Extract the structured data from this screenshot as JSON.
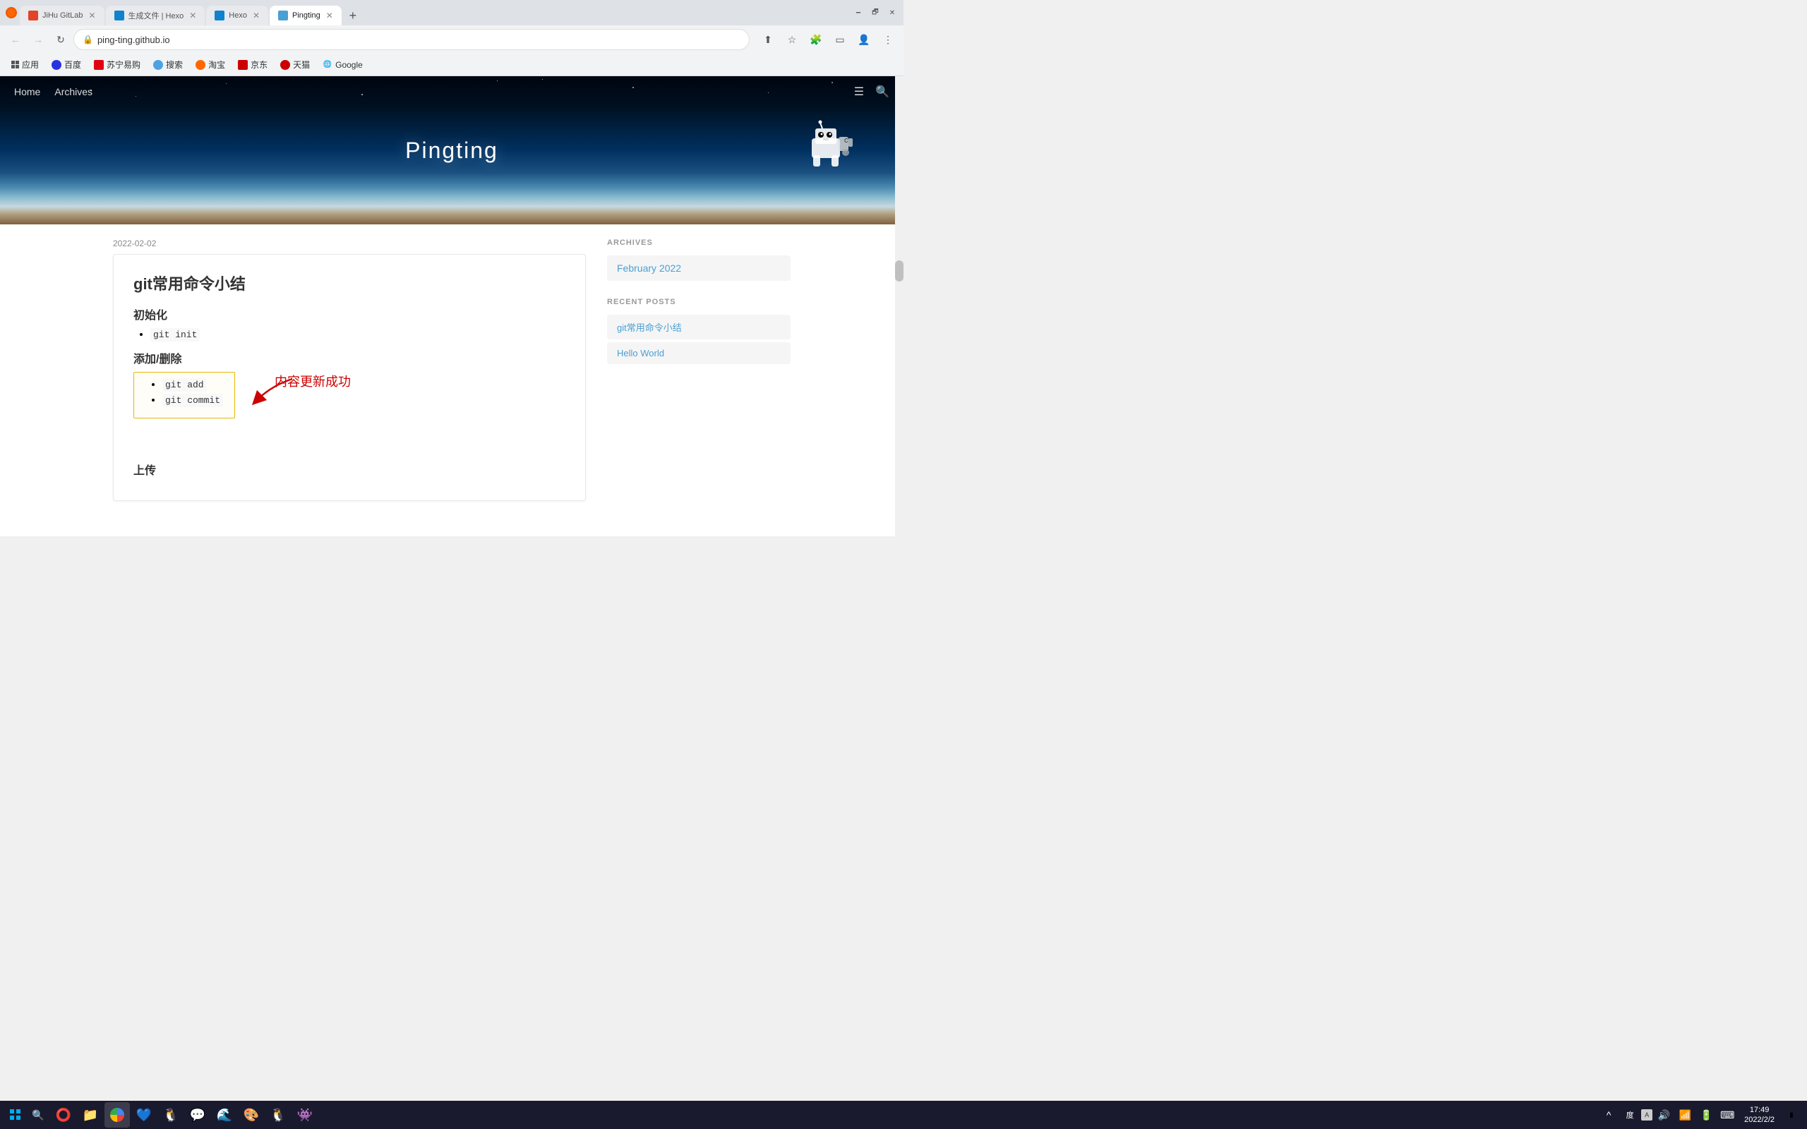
{
  "browser": {
    "tabs": [
      {
        "id": "tab1",
        "label": "JiHu GitLab",
        "favicon_color": "#e24329",
        "active": false
      },
      {
        "id": "tab2",
        "label": "生成文件 | Hexo",
        "favicon_color": "#0f83cd",
        "active": false
      },
      {
        "id": "tab3",
        "label": "Hexo",
        "favicon_color": "#0f83cd",
        "active": false
      },
      {
        "id": "tab4",
        "label": "Pingting",
        "favicon_color": "#4a9fd4",
        "active": true
      }
    ],
    "url": "ping-ting.github.io",
    "new_tab_label": "+",
    "minimize_label": "🗕",
    "maximize_label": "🗗",
    "close_label": "✕"
  },
  "bookmarks": [
    {
      "label": "应用",
      "favicon": "⬛"
    },
    {
      "label": "百度",
      "favicon": "🔵"
    },
    {
      "label": "苏宁易购",
      "favicon": "🔵"
    },
    {
      "label": "搜索",
      "favicon": "🔵"
    },
    {
      "label": "淘宝",
      "favicon": "🔵"
    },
    {
      "label": "京东",
      "favicon": "🔵"
    },
    {
      "label": "天猫",
      "favicon": "🔵"
    },
    {
      "label": "Google",
      "favicon": "🌐"
    }
  ],
  "site": {
    "title": "Pingting",
    "nav": {
      "home": "Home",
      "archives": "Archives"
    }
  },
  "post": {
    "date": "2022-02-02",
    "title": "git常用命令小结",
    "section1": {
      "heading": "初始化",
      "items": [
        "git init"
      ]
    },
    "section2": {
      "heading": "添加/删除",
      "items": [
        "git add",
        "git commit"
      ]
    },
    "section3": {
      "heading": "上传"
    },
    "annotation": "内容更新成功"
  },
  "sidebar": {
    "archives_title": "ARCHIVES",
    "archives_items": [
      {
        "label": "February 2022"
      }
    ],
    "recent_title": "RECENT POSTS",
    "recent_items": [
      {
        "label": "git常用命令小结"
      },
      {
        "label": "Hello World"
      }
    ]
  },
  "taskbar": {
    "start_icon": "⊞",
    "search_icon": "🔍",
    "apps": [
      "📁",
      "🌐",
      "💙",
      "📝",
      "🦊",
      "🎨",
      "🐧",
      "🤖"
    ],
    "time": "17:49",
    "date": "2022/2/2",
    "show_desktop": "🗖"
  }
}
